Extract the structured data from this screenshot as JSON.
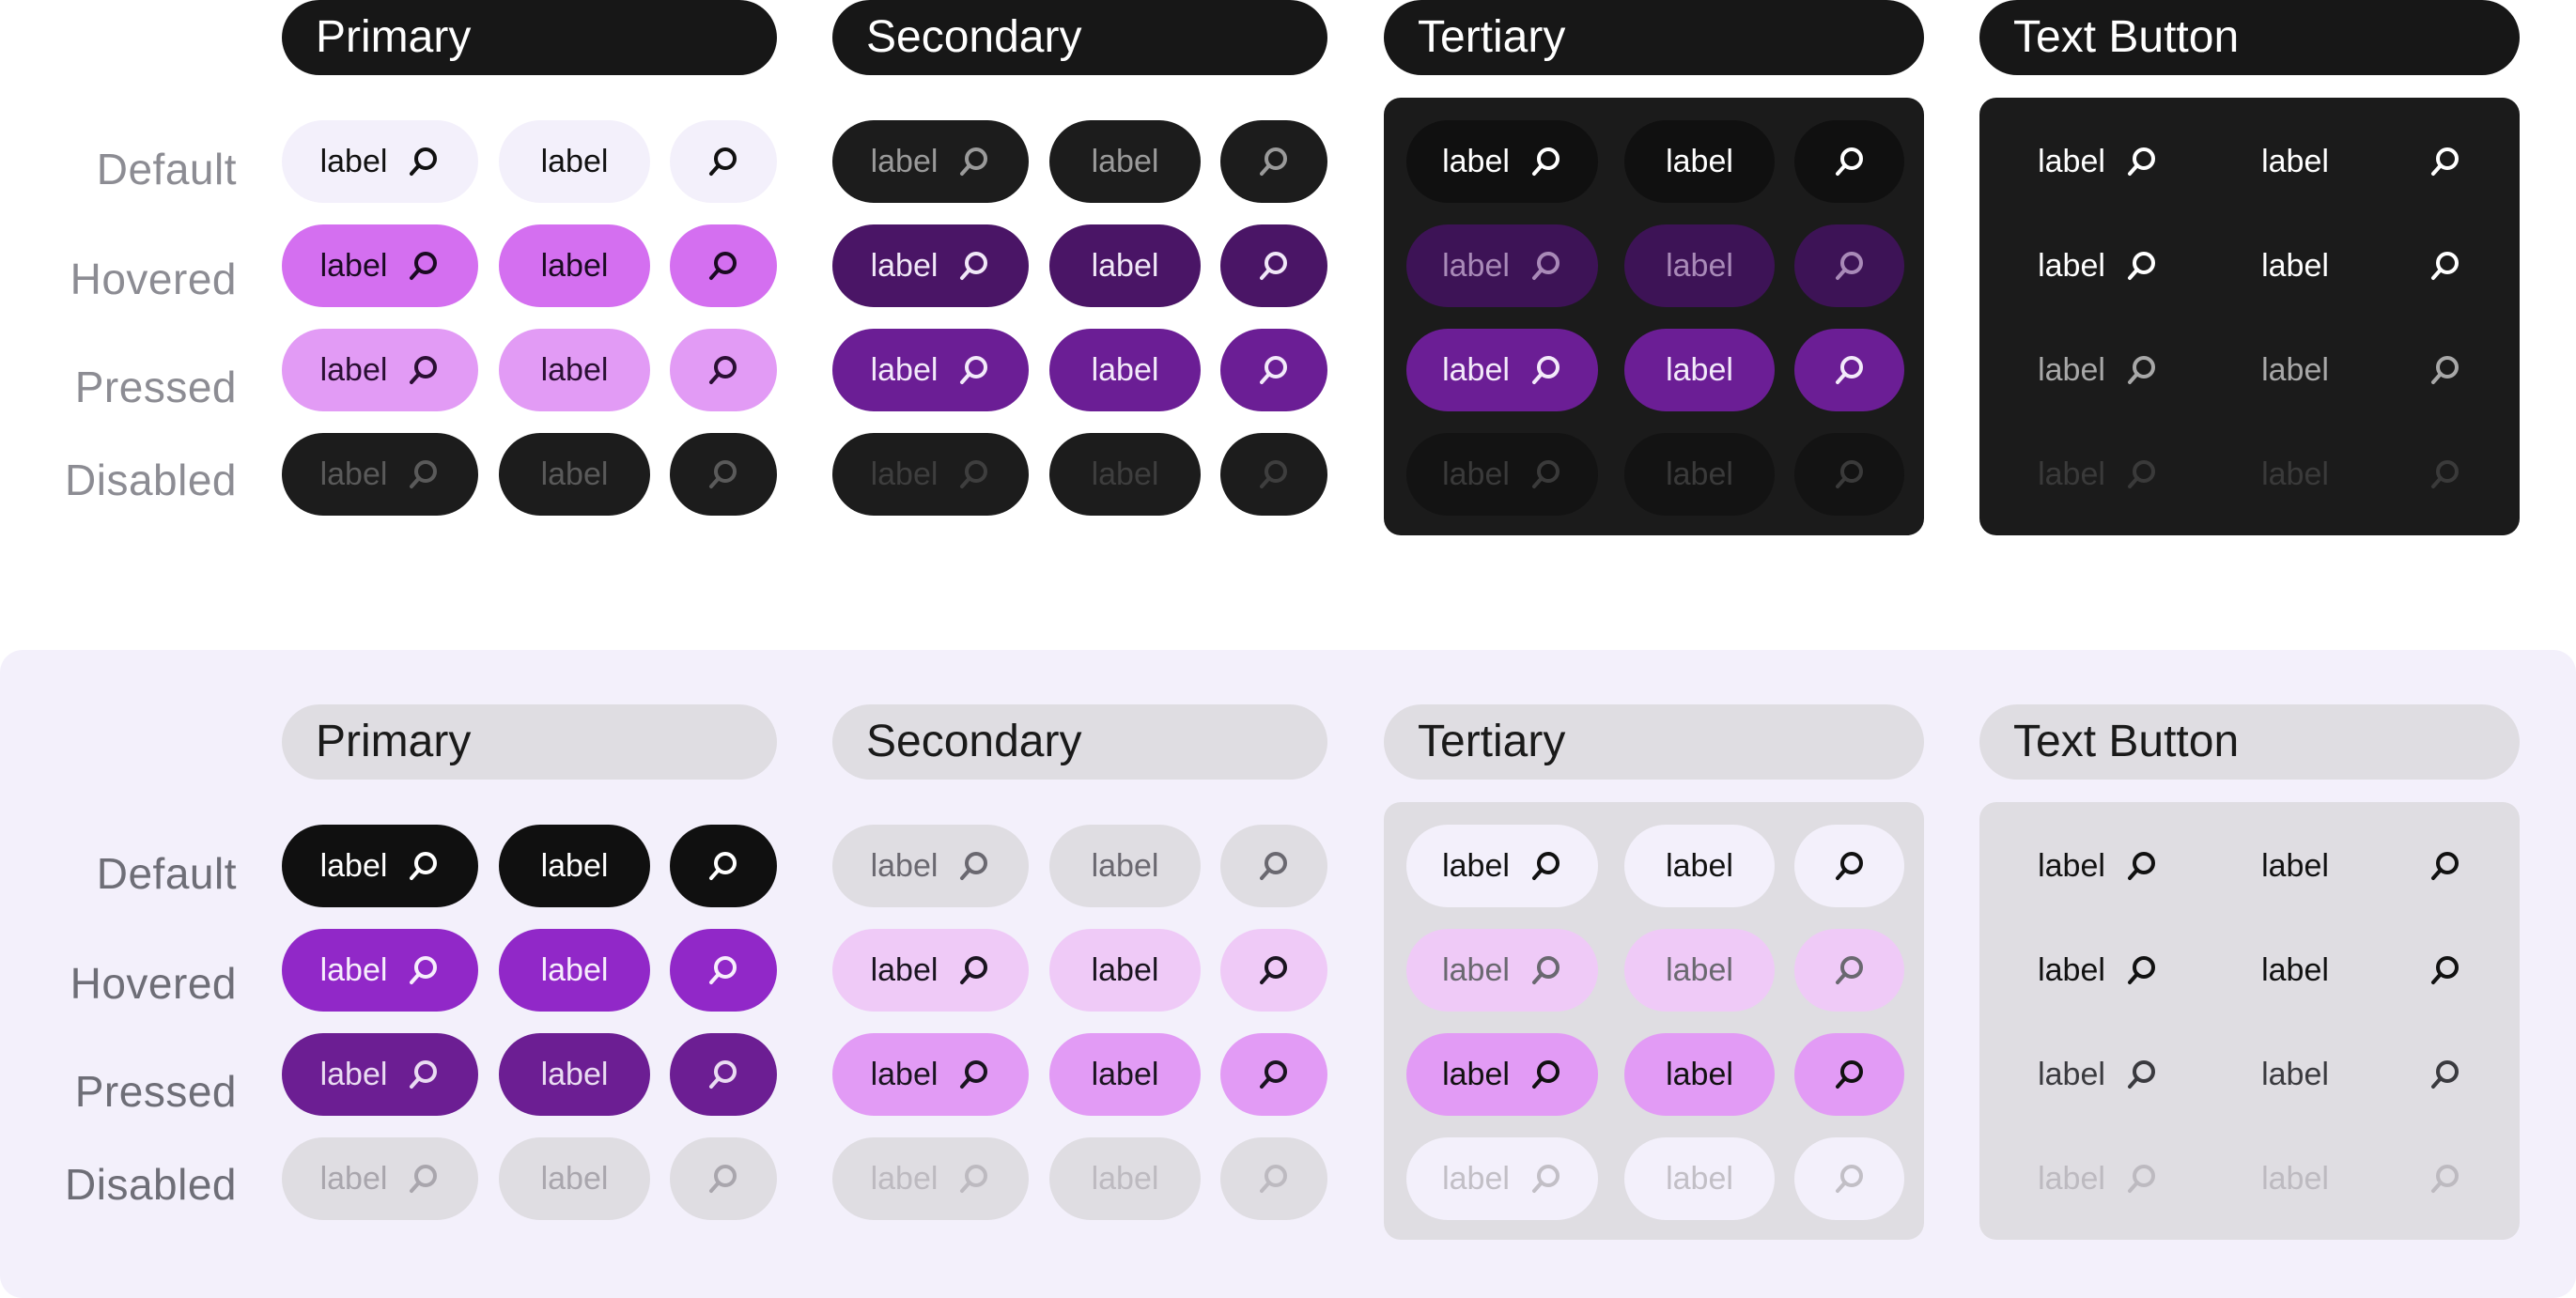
{
  "rows": [
    "Default",
    "Hovered",
    "Pressed",
    "Disabled"
  ],
  "button_label": "label",
  "icon": "search-icon",
  "sections": [
    {
      "theme": "dark-on-light",
      "groups": [
        {
          "title": "Primary",
          "styles": [
            {
              "bg": "#f3f0fb",
              "fg": "#111111"
            },
            {
              "bg": "#d46ff0",
              "fg": "#1a0a22"
            },
            {
              "bg": "#e29bf5",
              "fg": "#2a0f33"
            },
            {
              "bg": "#1c1c1c",
              "fg": "#5a5a5a"
            }
          ]
        },
        {
          "title": "Secondary",
          "styles": [
            {
              "bg": "#1c1c1c",
              "fg": "#9a9a9a"
            },
            {
              "bg": "#4a1566",
              "fg": "#f1e8f8"
            },
            {
              "bg": "#6b1e95",
              "fg": "#f3eafa"
            },
            {
              "bg": "#1c1c1c",
              "fg": "#3e3e3e"
            }
          ]
        },
        {
          "title": "Tertiary",
          "styles": [
            {
              "bg": "#101010",
              "fg": "#ffffff"
            },
            {
              "bg": "#3d1356",
              "fg": "#a98ab8"
            },
            {
              "bg": "#6b1e95",
              "fg": "#f3eafa"
            },
            {
              "bg": "#131313",
              "fg": "#3a3a3a"
            }
          ]
        },
        {
          "title": "Text Button",
          "styles": [
            {
              "bg": "transparent",
              "fg": "#ffffff"
            },
            {
              "bg": "transparent",
              "fg": "#ffffff"
            },
            {
              "bg": "transparent",
              "fg": "#a8a8a8"
            },
            {
              "bg": "transparent",
              "fg": "#3a3a3a"
            }
          ]
        }
      ]
    },
    {
      "theme": "light-on-lavender",
      "groups": [
        {
          "title": "Primary",
          "styles": [
            {
              "bg": "#101010",
              "fg": "#ffffff"
            },
            {
              "bg": "#9128c8",
              "fg": "#f7eefc"
            },
            {
              "bg": "#6c1e93",
              "fg": "#eadcf2"
            },
            {
              "bg": "#dfdde2",
              "fg": "#a9a6ad"
            }
          ]
        },
        {
          "title": "Secondary",
          "styles": [
            {
              "bg": "#dfdde2",
              "fg": "#6a6870"
            },
            {
              "bg": "#efcaf7",
              "fg": "#1a1420"
            },
            {
              "bg": "#e29bf5",
              "fg": "#1a1420"
            },
            {
              "bg": "#dfdde2",
              "fg": "#bdbac0"
            }
          ]
        },
        {
          "title": "Tertiary",
          "styles": [
            {
              "bg": "#f3f0fb",
              "fg": "#111111"
            },
            {
              "bg": "#efcaf7",
              "fg": "#6a6870"
            },
            {
              "bg": "#e29bf5",
              "fg": "#111111"
            },
            {
              "bg": "#f3f0fb",
              "fg": "#c2bfc6"
            }
          ]
        },
        {
          "title": "Text Button",
          "styles": [
            {
              "bg": "transparent",
              "fg": "#111111"
            },
            {
              "bg": "transparent",
              "fg": "#111111"
            },
            {
              "bg": "transparent",
              "fg": "#3a3a3f"
            },
            {
              "bg": "transparent",
              "fg": "#bdbac0"
            }
          ]
        }
      ]
    }
  ]
}
